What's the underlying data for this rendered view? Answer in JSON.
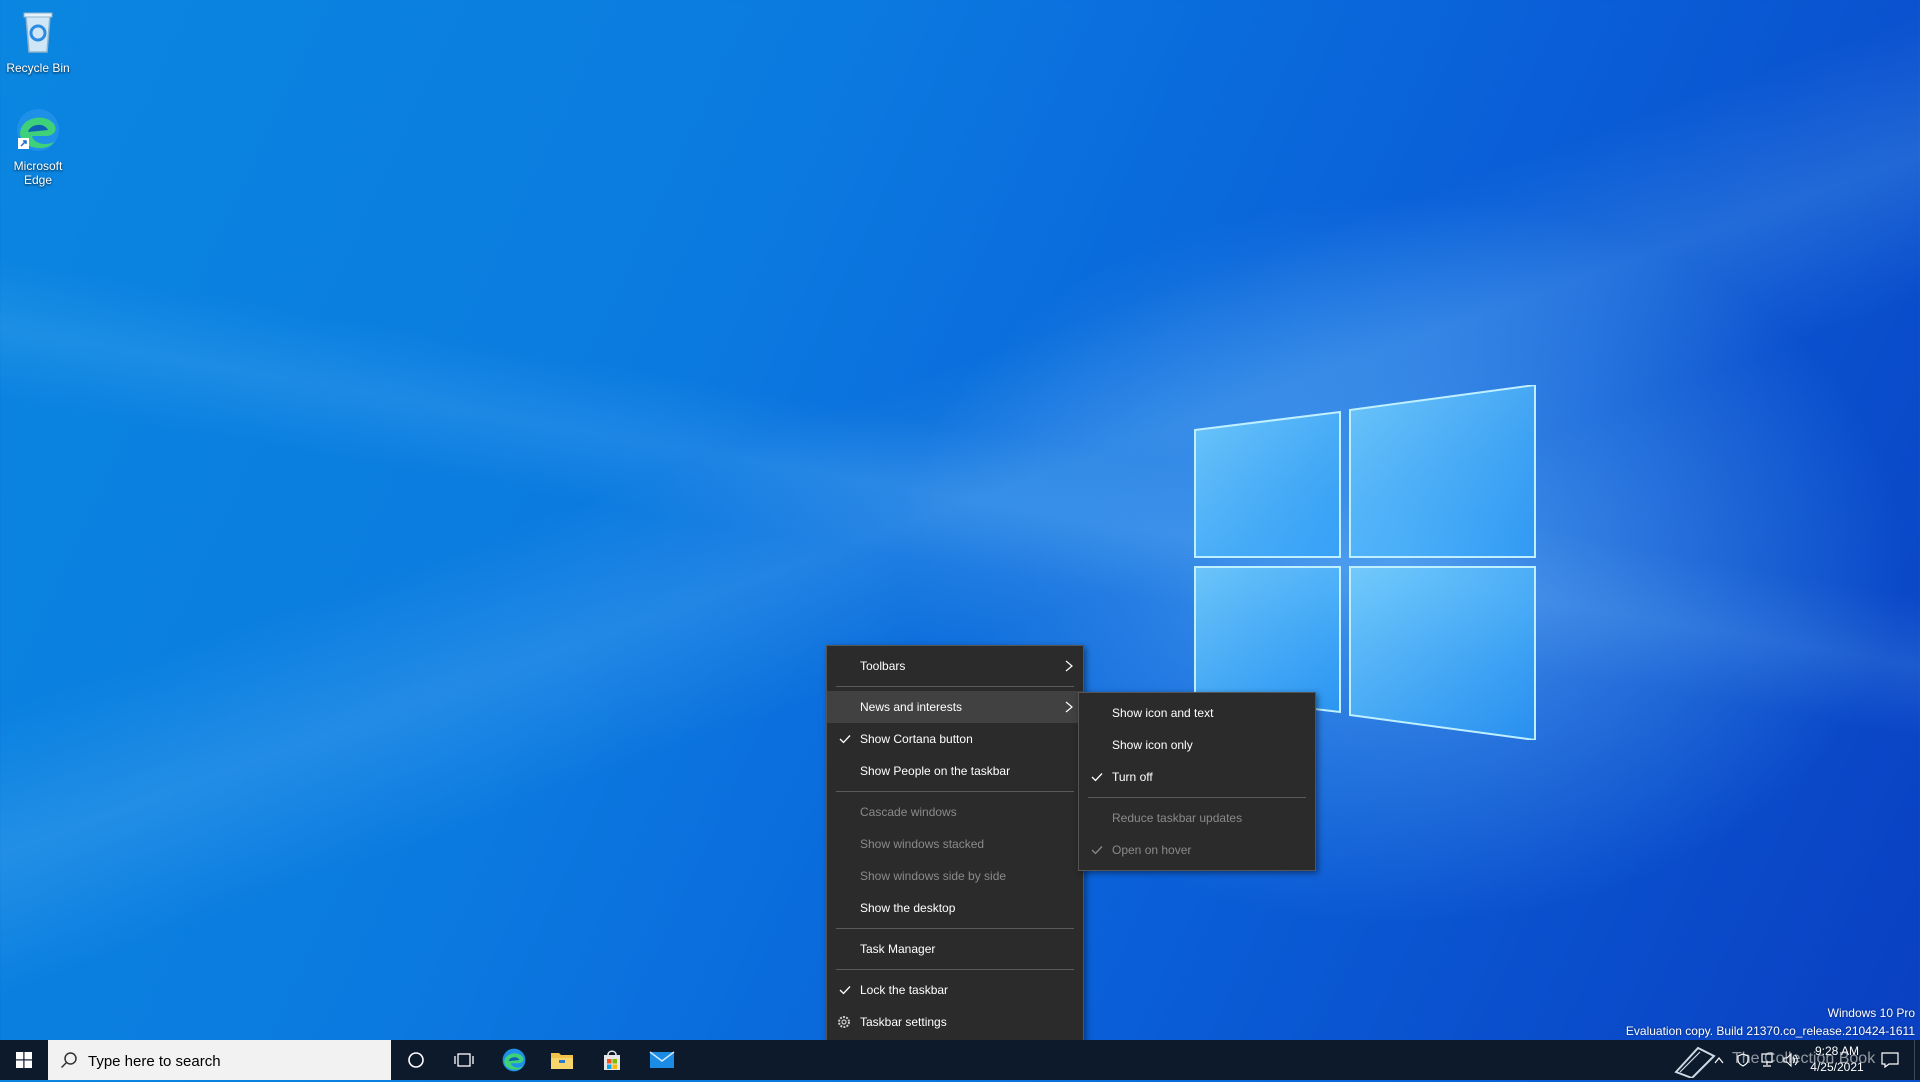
{
  "desktop": {
    "icons": [
      {
        "label": "Recycle Bin"
      },
      {
        "label": "Microsoft Edge"
      }
    ]
  },
  "context_menu": {
    "items": [
      {
        "label": "Toolbars",
        "state": "normal",
        "checked": false,
        "submenu": true
      },
      {
        "label": "News and interests",
        "state": "highlighted",
        "checked": false,
        "submenu": true
      },
      {
        "label": "Show Cortana button",
        "state": "normal",
        "checked": true
      },
      {
        "label": "Show People on the taskbar",
        "state": "normal",
        "checked": false
      },
      {
        "label": "Cascade windows",
        "state": "disabled"
      },
      {
        "label": "Show windows stacked",
        "state": "disabled"
      },
      {
        "label": "Show windows side by side",
        "state": "disabled"
      },
      {
        "label": "Show the desktop",
        "state": "normal"
      },
      {
        "label": "Task Manager",
        "state": "normal"
      },
      {
        "label": "Lock the taskbar",
        "state": "normal",
        "checked": true
      },
      {
        "label": "Taskbar settings",
        "state": "normal",
        "icon": "gear-icon"
      }
    ]
  },
  "submenu": {
    "items": [
      {
        "label": "Show icon and text",
        "state": "normal",
        "checked": false
      },
      {
        "label": "Show icon only",
        "state": "normal",
        "checked": false
      },
      {
        "label": "Turn off",
        "state": "normal",
        "checked": true
      },
      {
        "label": "Reduce taskbar updates",
        "state": "disabled",
        "checked": false
      },
      {
        "label": "Open on hover",
        "state": "disabled",
        "checked": true
      }
    ]
  },
  "taskbar": {
    "search_placeholder": "Type here to search",
    "apps": [
      "cortana-icon",
      "task-view-icon",
      "edge-icon",
      "file-explorer-icon",
      "store-icon",
      "mail-icon"
    ],
    "clock_time": "9:28 AM",
    "clock_date": "4/25/2021"
  },
  "watermark": {
    "line1": "Windows 10 Pro",
    "line2": "Evaluation copy. Build 21370.co_release.210424-1611",
    "overlay": "The Collection Book"
  },
  "colors": {
    "menu_bg": "#2b2b2b",
    "menu_highlight": "#414141",
    "taskbar_bg": "#0c1a2b",
    "wallpaper_accent": "#0a78d8"
  }
}
